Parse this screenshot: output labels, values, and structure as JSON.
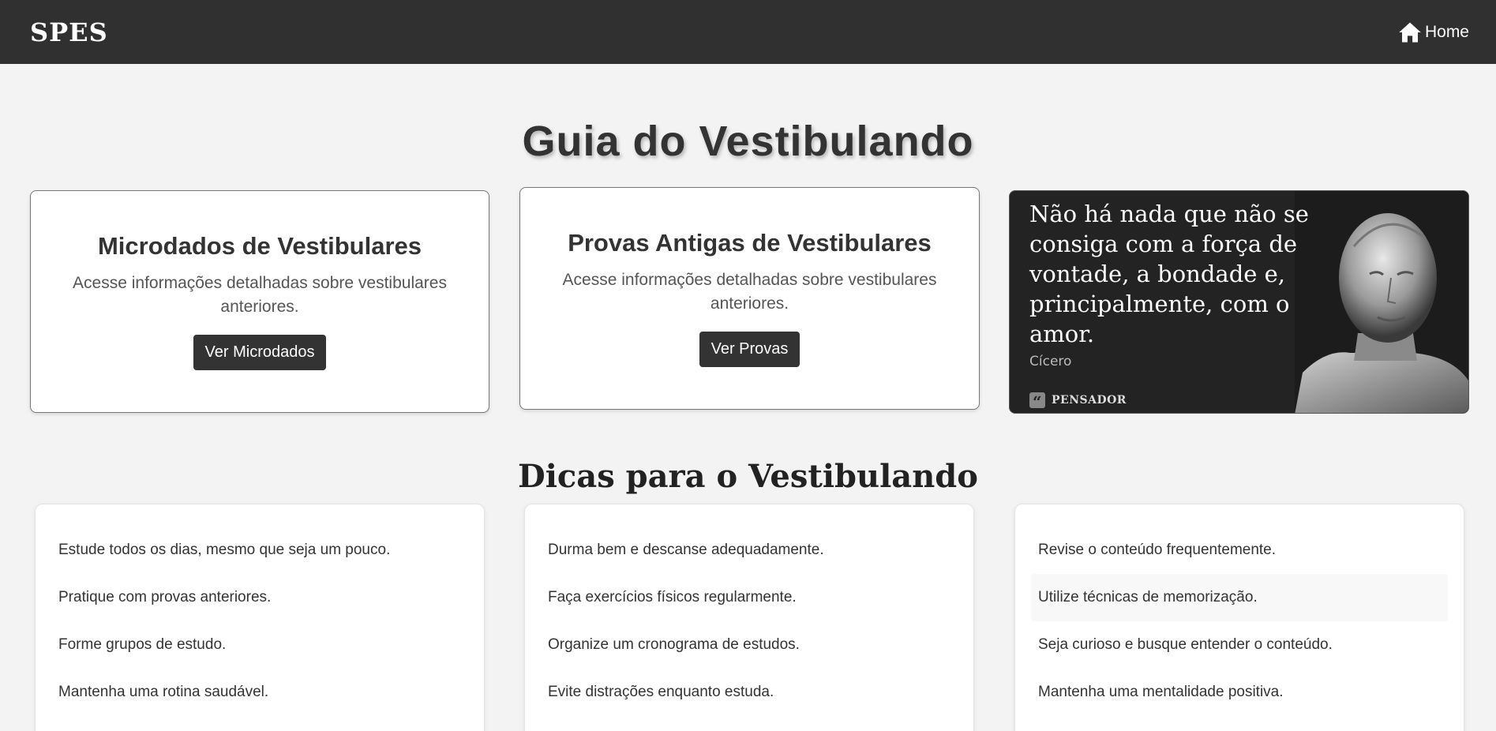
{
  "navbar": {
    "brand": "SPES",
    "home_label": "Home",
    "home_icon": "home-icon"
  },
  "page_title": "Guia do Vestibulando",
  "cards": [
    {
      "title": "Microdados de Vestibulares",
      "description": "Acesse informações detalhadas sobre vestibulares anteriores.",
      "button": "Ver Microdados"
    },
    {
      "title": "Provas Antigas de Vestibulares",
      "description": "Acesse informações detalhadas sobre vestibulares anteriores.",
      "button": "Ver Provas"
    }
  ],
  "quote": {
    "text": "Não há nada que não se consiga com a força de vontade, a bondade e, principalmente, com o amor.",
    "author": "Cícero",
    "source": "PENSADOR"
  },
  "tips_title": "Dicas para o Vestibulando",
  "tips": [
    {
      "items": [
        "Estude todos os dias, mesmo que seja um pouco.",
        "Pratique com provas anteriores.",
        "Forme grupos de estudo.",
        "Mantenha uma rotina saudável."
      ]
    },
    {
      "items": [
        "Durma bem e descanse adequadamente.",
        "Faça exercícios físicos regularmente.",
        "Organize um cronograma de estudos.",
        "Evite distrações enquanto estuda."
      ]
    },
    {
      "items": [
        "Revise o conteúdo frequentemente.",
        "Utilize técnicas de memorização.",
        "Seja curioso e busque entender o conteúdo.",
        "Mantenha uma mentalidade positiva."
      ]
    }
  ],
  "colors": {
    "navbar": "#303030",
    "background": "#f3f3f3",
    "button": "#333333"
  }
}
